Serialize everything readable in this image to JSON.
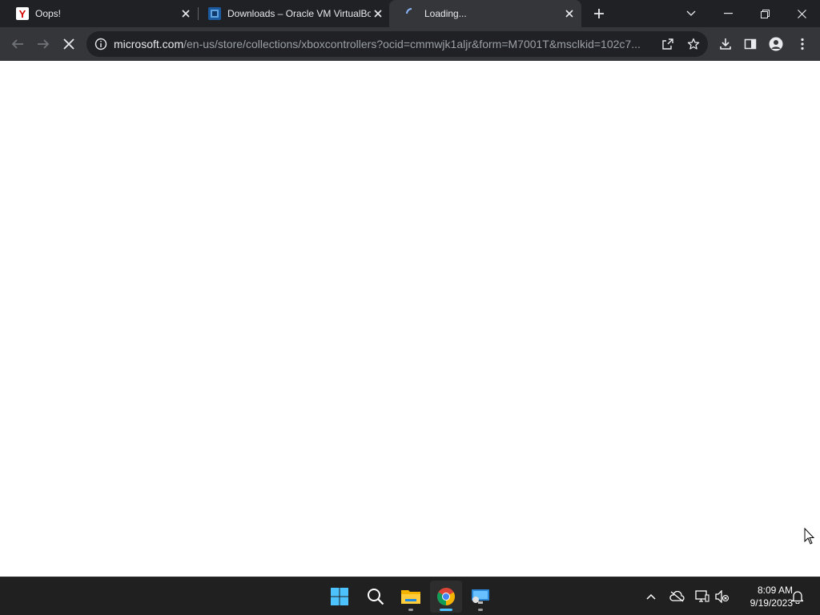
{
  "browser": {
    "tabs": [
      {
        "title": "Oops!",
        "favicon": "yahoo-icon",
        "active": false
      },
      {
        "title": "Downloads – Oracle VM VirtualBox",
        "favicon": "virtualbox-icon",
        "active": false
      },
      {
        "title": "Loading...",
        "favicon": "loading-spinner-icon",
        "active": true
      }
    ],
    "new_tab_icon": "plus-icon",
    "window_controls": [
      "chevron-down-icon",
      "minimize-icon",
      "restore-icon",
      "close-icon"
    ],
    "toolbar": {
      "back_icon": "back-arrow-icon",
      "forward_icon": "forward-arrow-icon",
      "stop_icon": "stop-loading-icon",
      "url_host": "microsoft.com",
      "url_path": "/en-us/store/collections/xboxcontrollers?ocid=cmmwjk1aljr&form=M7001T&msclkid=102c7...",
      "share_icon": "share-icon",
      "bookmark_icon": "star-icon",
      "download_icon": "download-icon",
      "sidepanel_icon": "side-panel-icon",
      "profile_icon": "profile-icon",
      "menu_icon": "kebab-menu-icon"
    }
  },
  "taskbar": {
    "apps": [
      "windows-start-icon",
      "search-icon",
      "file-explorer-icon",
      "chrome-icon",
      "remote-desktop-icon"
    ],
    "active_app": "chrome-icon",
    "tray": [
      "chevron-up-icon",
      "onedrive-offline-icon",
      "network-icon",
      "volume-muted-icon"
    ],
    "time": "8:09 AM",
    "date": "9/19/2023",
    "notification_icon": "bell-icon"
  },
  "colors": {
    "tabstrip": "#202124",
    "toolbar": "#35363a",
    "omnibox": "#202124",
    "taskbar": "#202020",
    "accent": "#4cc2ff"
  }
}
